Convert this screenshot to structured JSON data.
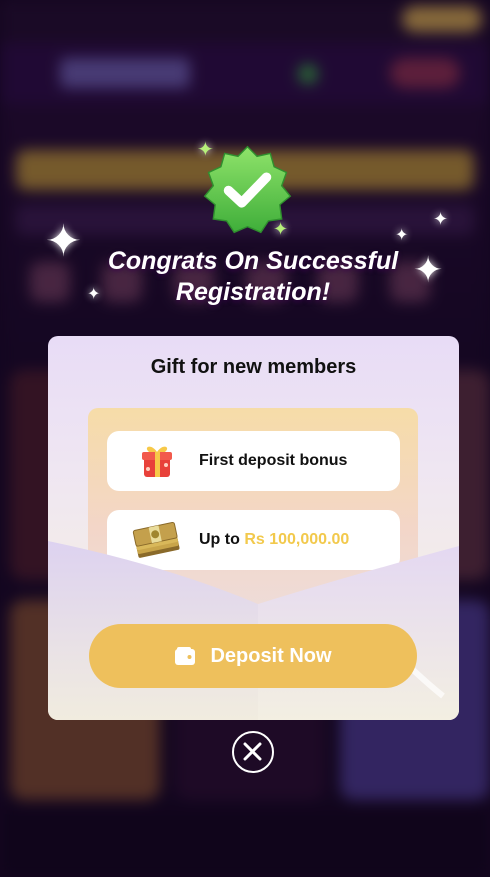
{
  "modal": {
    "headline_line1": "Congrats On Successful",
    "headline_line2": "Registration!",
    "card_title": "Gift for new members",
    "bonuses": [
      {
        "icon": "gift-box-icon",
        "label": "First deposit bonus"
      },
      {
        "icon": "cash-stack-icon",
        "label_prefix": "Up to",
        "amount": "Rs 100,000.00"
      }
    ],
    "deposit_button_label": "Deposit Now",
    "icons": {
      "badge": "check-badge-icon",
      "deposit": "wallet-icon",
      "close": "close-icon"
    }
  },
  "colors": {
    "badge_green": "#5ccf4a",
    "button_gold": "#eec05c",
    "amount_gold": "#f2c94c",
    "overlay": "#1a0a26"
  }
}
